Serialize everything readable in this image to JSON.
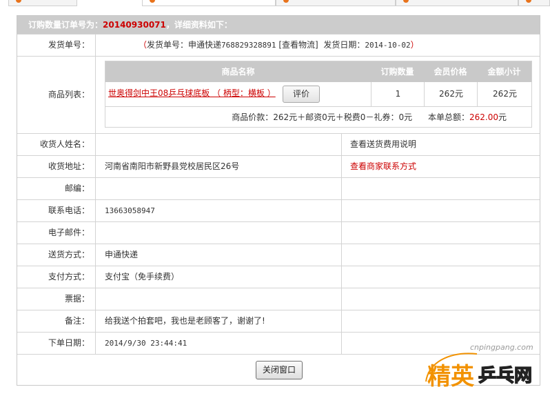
{
  "order": {
    "header_prefix": "订购数量订单号为：",
    "order_no": "20140930071",
    "header_suffix": "，详细资料如下："
  },
  "shipping": {
    "label": "发货单号：",
    "open_paren": "（",
    "text_prefix": "发货单号：申通快递",
    "tracking_no": "768829328891",
    "track_link": "[查看物流]",
    "date_label": "发货日期：",
    "date": "2014-10-02",
    "close_paren": "）"
  },
  "products": {
    "label": "商品列表：",
    "headers": {
      "name": "商品名称",
      "qty": "订购数量",
      "price": "会员价格",
      "subtotal": "金额小计"
    },
    "items": [
      {
        "name": "世奥得剑中王08乒乓球底板 （ 柄型：横板 ）",
        "review": "评价",
        "qty": "1",
        "price": "262元",
        "subtotal": "262元"
      }
    ],
    "summary_prefix": "商品价款：262元＋邮资0元＋税费0－礼券：0元",
    "total_label": "本单总额：",
    "total": "262.00",
    "total_unit": "元"
  },
  "fields": {
    "receiver_label": "收货人姓名：",
    "receiver_value": "",
    "shipping_fee_note": "查看送货费用说明",
    "address_label": "收货地址：",
    "address_value": "河南省南阳市新野县党校居民区26号",
    "merchant_contact": "查看商家联系方式",
    "zip_label": "邮编：",
    "zip_value": "",
    "phone_label": "联系电话：",
    "phone_value": "13663058947",
    "email_label": "电子邮件：",
    "email_value": "",
    "delivery_label": "送货方式：",
    "delivery_value": "申通快递",
    "payment_label": "支付方式：",
    "payment_value": "支付宝（免手续费）",
    "invoice_label": "票据：",
    "invoice_value": "",
    "remark_label": "备注：",
    "remark_value": "给我送个拍套吧，我也是老顾客了，谢谢了!",
    "order_date_label": "下单日期：",
    "order_date_value": "2014/9/30 23:44:41"
  },
  "close_button": "关闭窗口",
  "watermark": {
    "url": "cnpingpang.com",
    "logo_text_1": "精英",
    "logo_text_2": "乒乓网"
  },
  "colors": {
    "accent_red": "#cc0000",
    "header_gray": "#cccccc",
    "logo_orange": "#f29200"
  }
}
